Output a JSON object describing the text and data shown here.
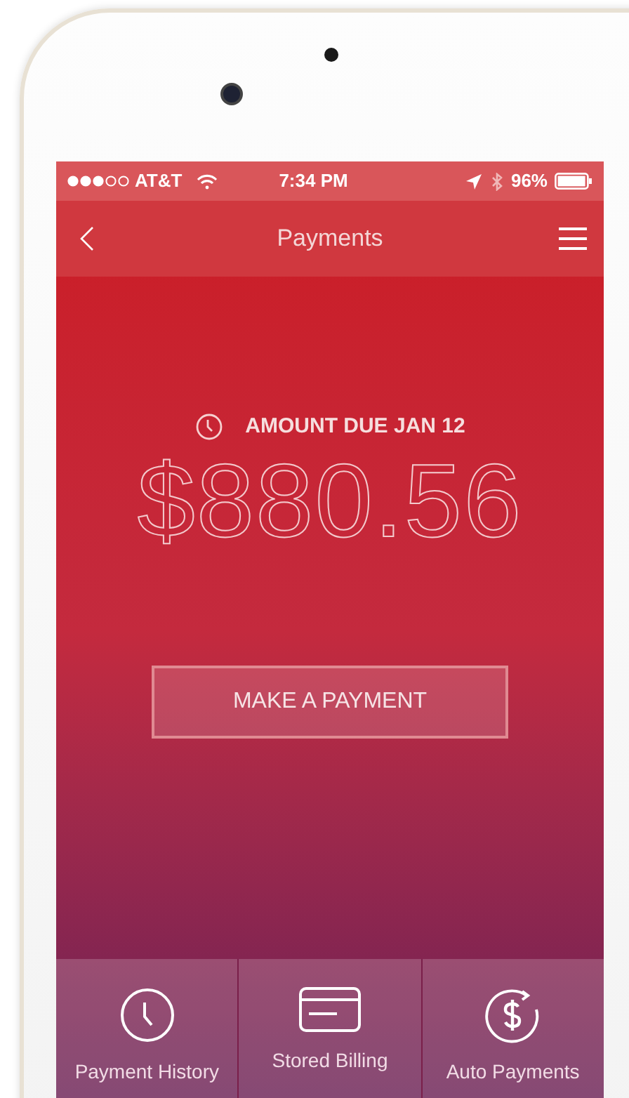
{
  "status_bar": {
    "carrier": "AT&T",
    "time": "7:34 PM",
    "battery": "96%"
  },
  "nav": {
    "title": "Payments"
  },
  "due": {
    "label": "AMOUNT DUE JAN 12",
    "amount": "$880.56"
  },
  "pay_button": {
    "label": "MAKE A PAYMENT"
  },
  "tabs": [
    {
      "kind": "history",
      "label": "Payment History"
    },
    {
      "kind": "billing",
      "label": "Stored Billing"
    },
    {
      "kind": "auto",
      "label": "Auto Payments"
    }
  ]
}
